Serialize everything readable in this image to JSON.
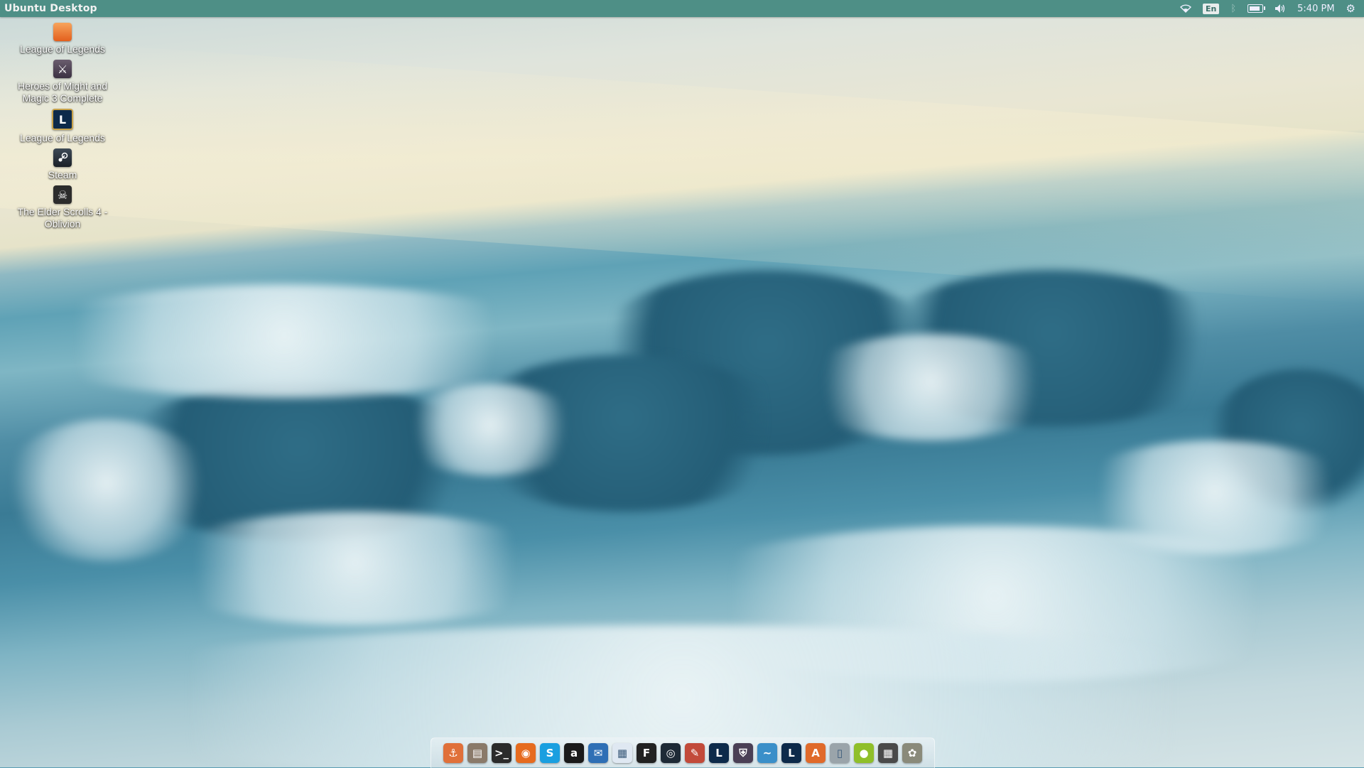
{
  "panel": {
    "title": "Ubuntu Desktop",
    "language": "En",
    "clock": "5:40 PM",
    "battery_level": 0.9
  },
  "desktop_icons": [
    {
      "label": "League of Legends",
      "icon": "folder-icon"
    },
    {
      "label": "Heroes of Might and Magic 3 Complete",
      "icon": "heroes-shield-icon"
    },
    {
      "label": "League of Legends",
      "icon": "league-of-legends-icon"
    },
    {
      "label": "Steam",
      "icon": "steam-icon"
    },
    {
      "label": "The Elder Scrolls 4 - Oblivion",
      "icon": "oblivion-icon"
    }
  ],
  "dock_items": [
    {
      "name": "anchor-icon",
      "glyph": "⚓",
      "color": "#e0703a"
    },
    {
      "name": "files-icon",
      "glyph": "▤",
      "color": "#8a7a6a"
    },
    {
      "name": "terminal-icon",
      "glyph": ">_",
      "color": "#2b2b2b"
    },
    {
      "name": "firefox-icon",
      "glyph": "◉",
      "color": "#e66b1f"
    },
    {
      "name": "skype-icon",
      "glyph": "S",
      "color": "#1a9fe0"
    },
    {
      "name": "amazon-icon",
      "glyph": "a",
      "color": "#1a1a1a"
    },
    {
      "name": "thunderbird-icon",
      "glyph": "✉",
      "color": "#2f6fb5"
    },
    {
      "name": "document-icon",
      "glyph": "▦",
      "color": "#dfe8f2"
    },
    {
      "name": "font-icon",
      "glyph": "F",
      "color": "#222222"
    },
    {
      "name": "steam-icon",
      "glyph": "◎",
      "color": "#1e2a36"
    },
    {
      "name": "tools-icon",
      "glyph": "✎",
      "color": "#c24a3a"
    },
    {
      "name": "league-of-legends-icon",
      "glyph": "L",
      "color": "#0d2a4a"
    },
    {
      "name": "heroes-shield-icon",
      "glyph": "⛨",
      "color": "#4a3f55"
    },
    {
      "name": "wine-icon",
      "glyph": "~",
      "color": "#3a8fc9"
    },
    {
      "name": "league-of-legends-icon-2",
      "glyph": "L",
      "color": "#0d2a4a"
    },
    {
      "name": "software-center-icon",
      "glyph": "A",
      "color": "#e06a2a"
    },
    {
      "name": "trash-icon",
      "glyph": "▯",
      "color": "#9aa4aa"
    },
    {
      "name": "green-orb-icon",
      "glyph": "●",
      "color": "#8fbf2a"
    },
    {
      "name": "workspaces-icon",
      "glyph": "▦",
      "color": "#4a4a4a"
    },
    {
      "name": "gimp-icon",
      "glyph": "✿",
      "color": "#8a8a7a"
    }
  ],
  "colors": {
    "panel": "#4e8f86",
    "sky_top": "#dfe4dc",
    "cloud_dark": "#245d76"
  }
}
